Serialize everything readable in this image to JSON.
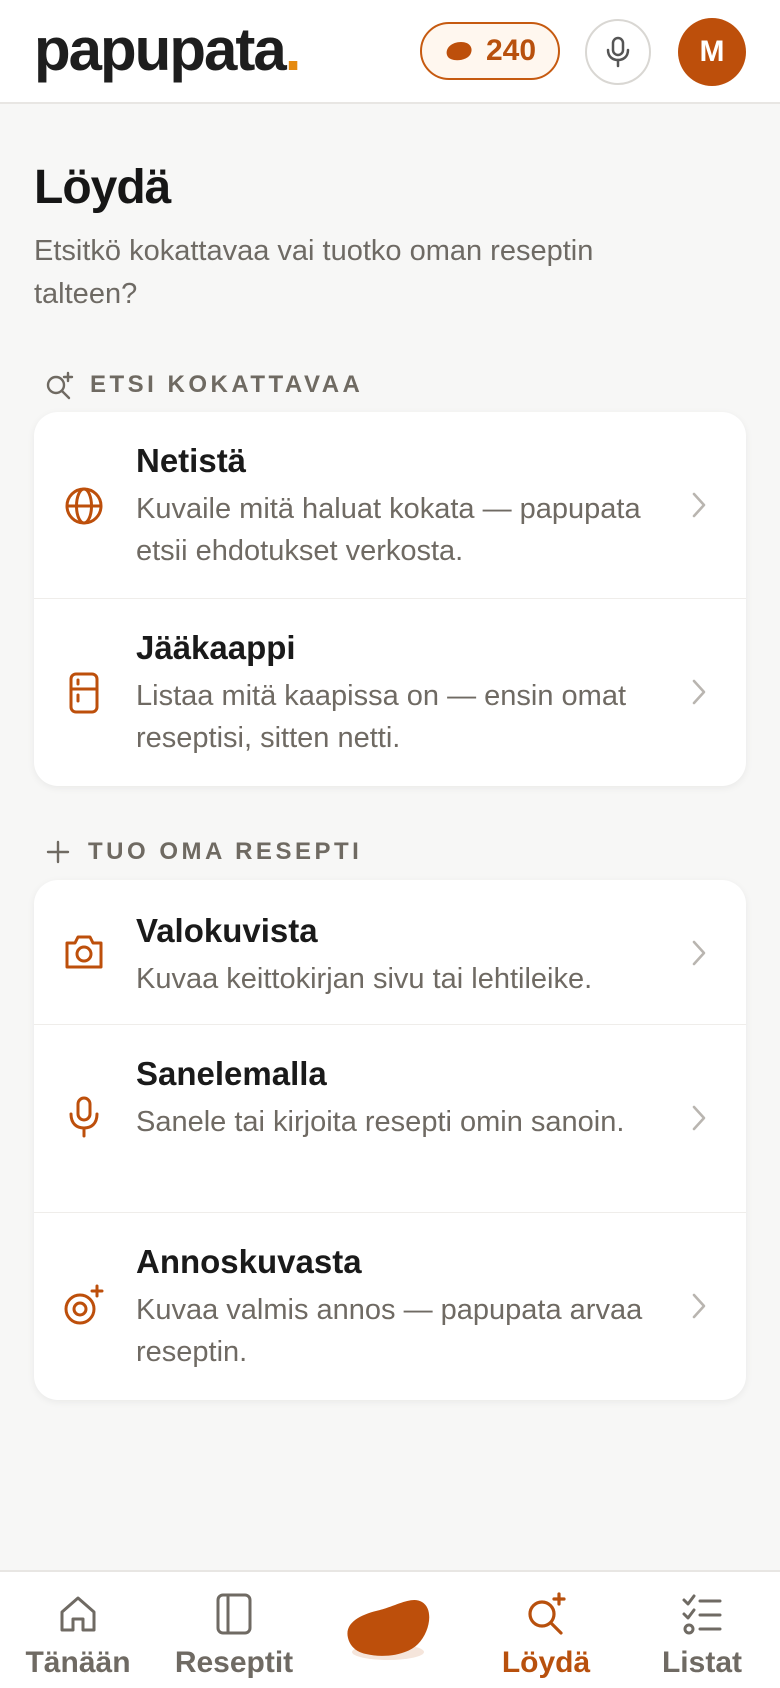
{
  "header": {
    "logo_text": "papupata",
    "logo_dot": ".",
    "beans_count": "240",
    "avatar_initial": "M"
  },
  "page": {
    "title": "Löydä",
    "subtitle": "Etsitkö kokattavaa vai tuotko oman reseptin talteen?"
  },
  "sections": [
    {
      "label": "ETSI KOKATTAVAA",
      "icon": "search-sparkle-icon",
      "items": [
        {
          "title": "Netistä",
          "desc": "Kuvaile mitä haluat kokata — papupata etsii ehdotukset verkosta.",
          "icon": "globe-icon"
        },
        {
          "title": "Jääkaappi",
          "desc": "Listaa mitä kaapissa on — ensin omat reseptisi, sitten netti.",
          "icon": "fridge-icon"
        }
      ]
    },
    {
      "label": "TUO OMA RESEPTI",
      "icon": "plus-icon",
      "items": [
        {
          "title": "Valokuvista",
          "desc": "Kuvaa keittokirjan sivu tai lehtileike.",
          "icon": "camera-icon"
        },
        {
          "title": "Sanelemalla",
          "desc": "Sanele tai kirjoita resepti omin sanoin.",
          "icon": "microphone-icon"
        },
        {
          "title": "Annoskuvasta",
          "desc": "Kuvaa valmis annos — papupata arvaa reseptin.",
          "icon": "target-sparkle-icon"
        }
      ]
    }
  ],
  "bottom_nav": {
    "tabs": [
      {
        "label": "Tänään",
        "icon": "home-icon"
      },
      {
        "label": "Reseptit",
        "icon": "book-icon"
      },
      {
        "label": "Löydä",
        "icon": "search-sparkle-icon",
        "active": true
      },
      {
        "label": "Listat",
        "icon": "checklist-icon"
      }
    ],
    "center_icon": "bean-icon"
  },
  "colors": {
    "accent": "#bd4f0b",
    "accent_text": "#b8500d",
    "logo_dot": "#e58a10",
    "background": "#f7f7f6"
  }
}
